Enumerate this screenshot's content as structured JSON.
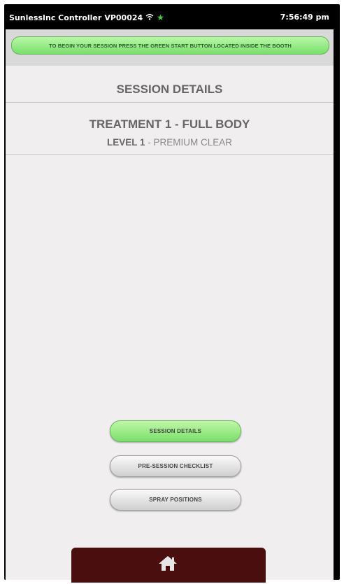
{
  "statusbar": {
    "app_title": "SunlessInc Controller",
    "device_id": "VP00024",
    "time": "7:56:49 pm",
    "wifi_icon": "wifi-icon",
    "star_icon": "star-icon"
  },
  "banner": {
    "text": "TO BEGIN YOUR SESSION PRESS THE GREEN START BUTTON LOCATED INSIDE THE BOOTH"
  },
  "main": {
    "title": "SESSION DETAILS",
    "treatment": "TREATMENT 1 - FULL BODY",
    "level_label": "LEVEL 1",
    "level_separator": " - ",
    "level_name": "PREMIUM CLEAR"
  },
  "nav": {
    "items": [
      {
        "label": "SESSION DETAILS",
        "active": true
      },
      {
        "label": "PRE-SESSION CHECKLIST",
        "active": false
      },
      {
        "label": "SPRAY POSITIONS",
        "active": false
      }
    ]
  },
  "footer": {
    "home_icon": "home-icon"
  },
  "colors": {
    "accent_green": "#79e06a",
    "footer_bg": "#4b0e0e",
    "screen_bg": "#f0eeee"
  }
}
